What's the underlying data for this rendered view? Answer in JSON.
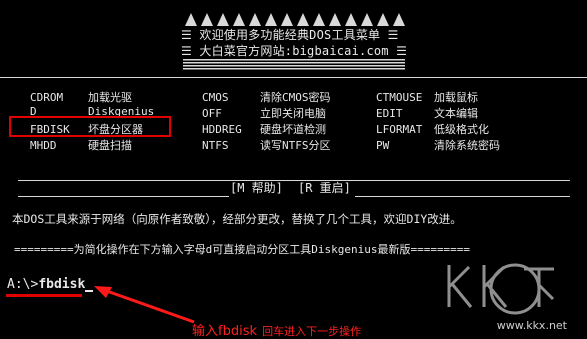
{
  "header": {
    "line1": "☰  欢迎使用多功能经典DOS工具菜单  ☰",
    "line2": "☰  大白菜官方网站:bigbaicai.com  ☰"
  },
  "menu_col1": [
    {
      "cmd": "CDROM",
      "desc": "加载光驱"
    },
    {
      "cmd": "D",
      "desc": "Diskgenius"
    },
    {
      "cmd": "FBDISK",
      "desc": "坏盘分区器"
    },
    {
      "cmd": "MHDD",
      "desc": "硬盘扫描"
    }
  ],
  "menu_col2": [
    {
      "cmd": "CMOS",
      "desc": "清除CMOS密码"
    },
    {
      "cmd": "OFF",
      "desc": "立即关闭电脑"
    },
    {
      "cmd": "HDDREG",
      "desc": "硬盘坏道检测"
    },
    {
      "cmd": "NTFS",
      "desc": "读写NTFS分区"
    }
  ],
  "menu_col3": [
    {
      "cmd": "CTMOUSE",
      "desc": "加载鼠标"
    },
    {
      "cmd": "EDIT",
      "desc": "文本编辑"
    },
    {
      "cmd": "LFORMAT",
      "desc": "低级格式化"
    },
    {
      "cmd": "PW",
      "desc": "清除系统密码"
    }
  ],
  "help_bar": {
    "help": "[M 帮助]",
    "restart": "[R 重启]"
  },
  "info_line": "本DOS工具来源于网络（向原作者致敬），经部分更改，替换了几个工具，欢迎DIY改进。",
  "tip_line": "=========为简化操作在下方输入字母d可直接启动分区工具Diskgenius最新版=========",
  "prompt": {
    "path": "A:\\>",
    "typed": "fbdisk"
  },
  "annotation": {
    "main": "输入fbdisk",
    "sub": "回车进入下一步操作"
  },
  "watermark": {
    "text": "www.kkx.net"
  },
  "colors": {
    "background": "#000000",
    "text": "#e8e8e8",
    "highlight": "#e00000"
  }
}
